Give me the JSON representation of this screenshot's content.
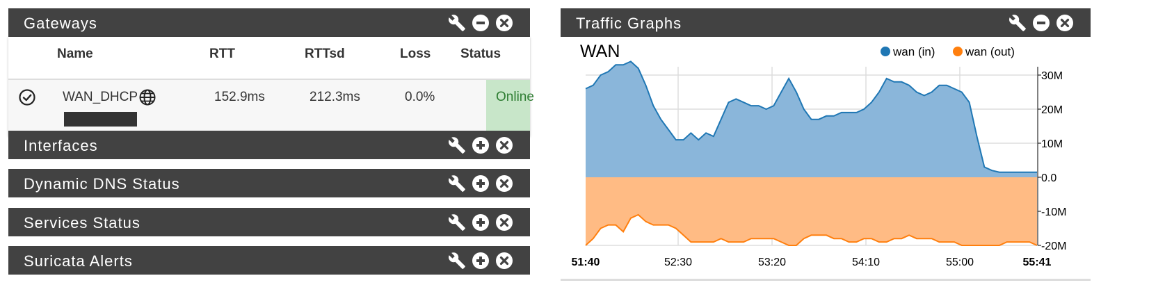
{
  "gateways": {
    "title": "Gateways",
    "columns": [
      "Name",
      "RTT",
      "RTTsd",
      "Loss",
      "Status"
    ],
    "row": {
      "name": "WAN_DHCP",
      "rtt": "152.9ms",
      "rttsd": "212.3ms",
      "loss": "0.0%",
      "status": "Online"
    }
  },
  "collapsed_panels": [
    {
      "title": "Interfaces"
    },
    {
      "title": "Dynamic DNS Status"
    },
    {
      "title": "Services Status"
    },
    {
      "title": "Suricata Alerts"
    }
  ],
  "traffic": {
    "title": "Traffic Graphs",
    "chart_data": {
      "type": "area",
      "title": "WAN",
      "legend_position": "top-right",
      "series": [
        {
          "name": "wan (in)",
          "color": "#1f77b4",
          "values": [
            26,
            27,
            30,
            31,
            33,
            33,
            34,
            32,
            27,
            21,
            17,
            14,
            11,
            11,
            13,
            11,
            13,
            12,
            17,
            22,
            23,
            22,
            21,
            21,
            20,
            21,
            25,
            29,
            25,
            20,
            17,
            17,
            18,
            18,
            19,
            19,
            19,
            20,
            22,
            25,
            29,
            28,
            28,
            27,
            25,
            24,
            25,
            27,
            27,
            26,
            25,
            22,
            12,
            3,
            2,
            1.5,
            1.5,
            1.5,
            1.5,
            1.5,
            1.5
          ]
        },
        {
          "name": "wan (out)",
          "color": "#ff7f0e",
          "values": [
            -20,
            -18,
            -15,
            -14,
            -14,
            -16,
            -12,
            -11,
            -13,
            -14,
            -14,
            -14,
            -15,
            -17,
            -19,
            -19,
            -19,
            -19,
            -18,
            -19,
            -19,
            -19,
            -18,
            -18,
            -18,
            -18,
            -19,
            -20,
            -20,
            -18,
            -17,
            -17,
            -17,
            -18,
            -18,
            -19,
            -19,
            -18,
            -18,
            -19,
            -19,
            -18,
            -18,
            -17,
            -18,
            -18,
            -18,
            -19,
            -19,
            -19,
            -20,
            -20,
            -20,
            -20,
            -20,
            -20,
            -19,
            -19,
            -19,
            -19,
            -20
          ]
        }
      ],
      "x_ticks": [
        "51:40",
        "52:30",
        "53:20",
        "54:10",
        "55:00",
        "55:41"
      ],
      "y_ticks": [
        "30M",
        "20M",
        "10M",
        "0.0",
        "-10M",
        "-20M"
      ],
      "ylim": [
        -20,
        30
      ],
      "grid": true
    }
  },
  "colors": {
    "header": "#424242",
    "online_bg": "#c8e6c9",
    "online_text": "#2e7d32",
    "area_in": "#7fb0d8",
    "area_out": "#ffbb84"
  },
  "icons": [
    "wrench-icon",
    "minus-circle-icon",
    "plus-circle-icon",
    "close-circle-icon",
    "check-circle-icon",
    "globe-icon"
  ]
}
